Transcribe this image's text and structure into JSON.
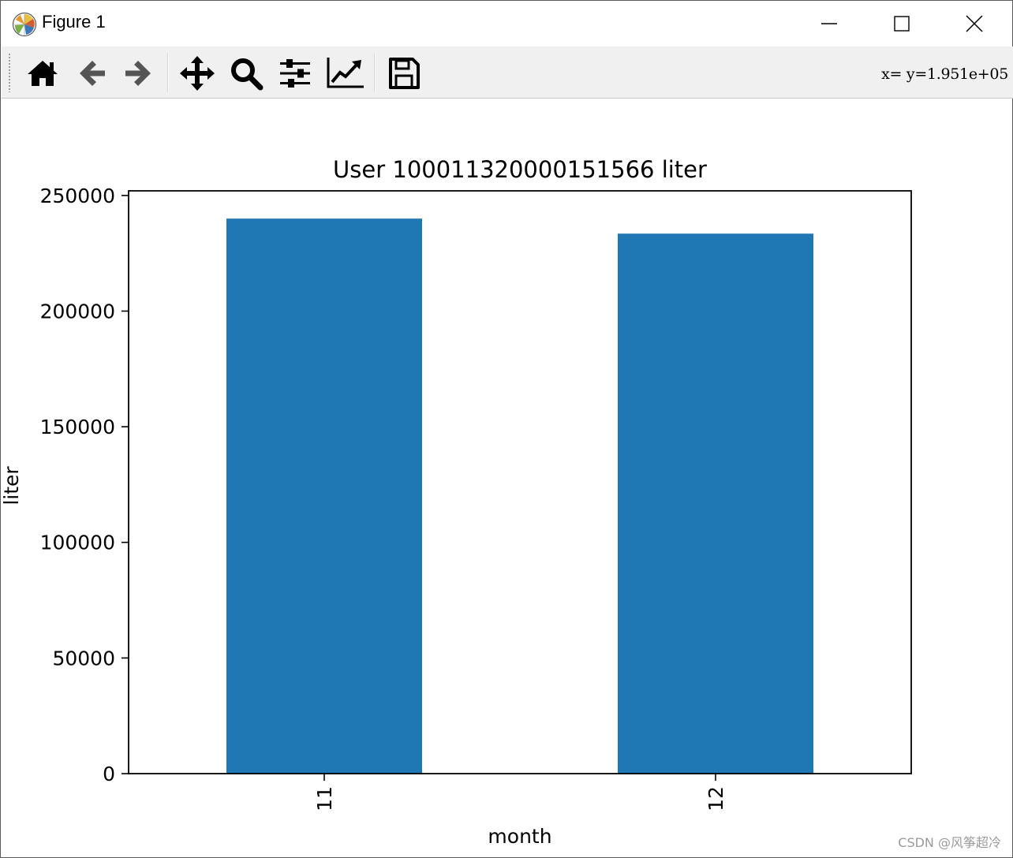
{
  "window": {
    "title": "Figure 1",
    "controls": [
      "minimize",
      "maximize",
      "close"
    ]
  },
  "toolbar": {
    "buttons": [
      {
        "name": "home",
        "icon": "home-icon"
      },
      {
        "name": "back",
        "icon": "arrow-left-icon"
      },
      {
        "name": "forward",
        "icon": "arrow-right-icon"
      },
      {
        "name": "pan",
        "icon": "move-icon"
      },
      {
        "name": "zoom",
        "icon": "search-icon"
      },
      {
        "name": "configure-subplots",
        "icon": "sliders-icon"
      },
      {
        "name": "edit-axis",
        "icon": "line-chart-icon"
      },
      {
        "name": "save",
        "icon": "floppy-disk-icon"
      }
    ],
    "coordinate_readout": "x= y=1.951e+05"
  },
  "chart_data": {
    "type": "bar",
    "title": "User 100011320000151566 liter",
    "xlabel": "month",
    "ylabel": "liter",
    "categories": [
      "11",
      "12"
    ],
    "values": [
      240000,
      233500
    ],
    "ylim": [
      0,
      252000
    ],
    "yticks": [
      0,
      50000,
      100000,
      150000,
      200000,
      250000
    ],
    "ytick_labels": [
      "0",
      "50000",
      "100000",
      "150000",
      "200000",
      "250000"
    ],
    "xtick_rotation": "vertical",
    "bar_color": "#1f77b4",
    "grid": false,
    "legend": "none"
  },
  "watermark": "CSDN @风筝超冷"
}
